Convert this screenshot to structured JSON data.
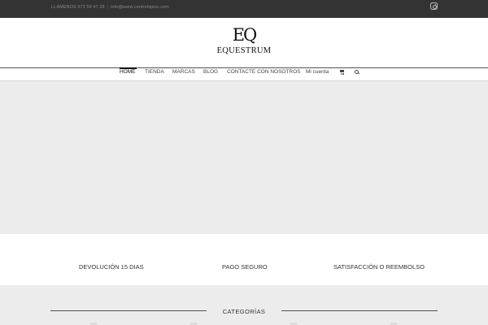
{
  "topbar": {
    "phone": "LLAMENOS 972 59 47 28",
    "separator": "|",
    "email": "info@www.centrohipico.com",
    "social_icon": "instagram-icon"
  },
  "logo": {
    "monogram": "EQ",
    "wordmark": "EQUESTRUM"
  },
  "nav": {
    "items": [
      {
        "label": "HOME",
        "active": true
      },
      {
        "label": "TIENDA"
      },
      {
        "label": "MARCAS"
      },
      {
        "label": "BLOG"
      },
      {
        "label": "CONTACTE CON NOSOTROS"
      },
      {
        "label": "Mi cuenta"
      }
    ],
    "cart_icon": "cart-icon",
    "search_icon": "search-icon"
  },
  "features": [
    {
      "label": "DEVOLUCIÓN 15 DIAS"
    },
    {
      "label": "PAGO SEGURO"
    },
    {
      "label": "SATISFACCIÓN O REEMBOLSO"
    }
  ],
  "categories": {
    "title": "CATEGORÍAS"
  },
  "colors": {
    "topbar_bg": "#333333",
    "hero_bg": "#ececec",
    "text_dark": "#333333"
  }
}
